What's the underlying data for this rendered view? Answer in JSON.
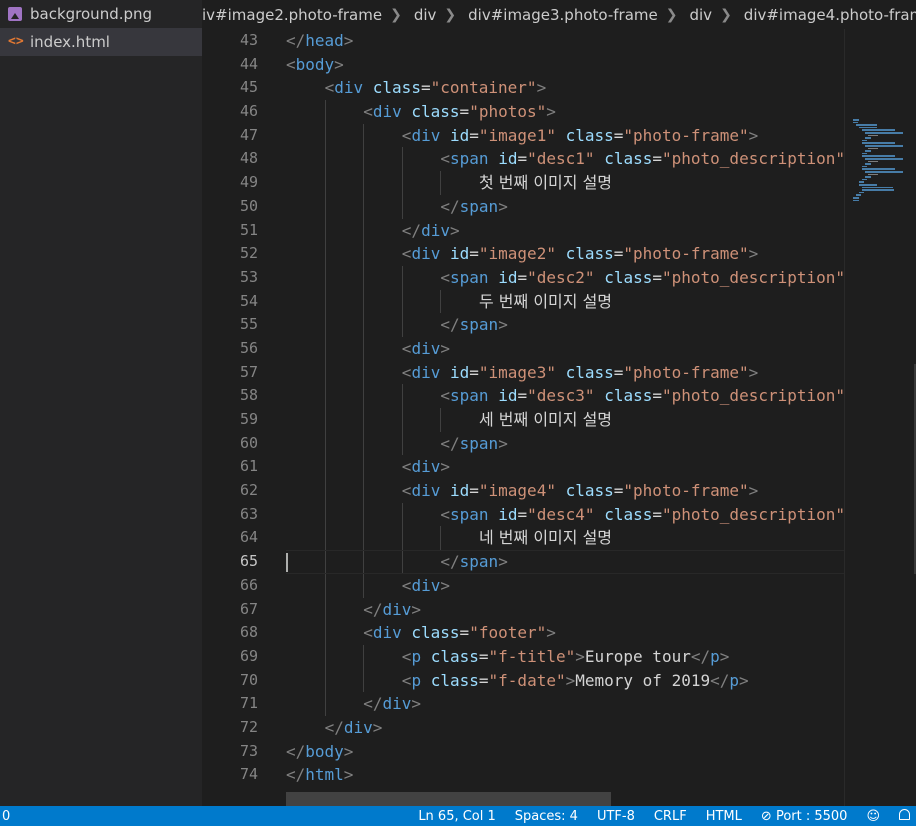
{
  "sidebar": {
    "files": [
      {
        "name": "background.png",
        "icon": "image-file-icon",
        "active": false
      },
      {
        "name": "index.html",
        "icon": "html-file-icon",
        "active": true
      }
    ]
  },
  "breadcrumb": {
    "items": [
      "iv#image2.photo-frame",
      "div",
      "div#image3.photo-frame",
      "div",
      "div#image4.photo-fram"
    ]
  },
  "editor": {
    "current_line": 65,
    "lines": [
      {
        "n": "43",
        "indent": 0,
        "tokens": [
          [
            "tb",
            "</"
          ],
          [
            "tg",
            "head"
          ],
          [
            "tb",
            ">"
          ]
        ]
      },
      {
        "n": "44",
        "indent": 0,
        "tokens": [
          [
            "tb",
            "<"
          ],
          [
            "tg",
            "body"
          ],
          [
            "tb",
            ">"
          ]
        ]
      },
      {
        "n": "45",
        "indent": 1,
        "tokens": [
          [
            "tb",
            "<"
          ],
          [
            "tg",
            "div"
          ],
          [
            "tx",
            " "
          ],
          [
            "at",
            "class"
          ],
          [
            "tx",
            "="
          ],
          [
            "st",
            "\"container\""
          ],
          [
            "tb",
            ">"
          ]
        ]
      },
      {
        "n": "46",
        "indent": 2,
        "tokens": [
          [
            "tb",
            "<"
          ],
          [
            "tg",
            "div"
          ],
          [
            "tx",
            " "
          ],
          [
            "at",
            "class"
          ],
          [
            "tx",
            "="
          ],
          [
            "st",
            "\"photos\""
          ],
          [
            "tb",
            ">"
          ]
        ]
      },
      {
        "n": "47",
        "indent": 3,
        "tokens": [
          [
            "tb",
            "<"
          ],
          [
            "tg",
            "div"
          ],
          [
            "tx",
            " "
          ],
          [
            "at",
            "id"
          ],
          [
            "tx",
            "="
          ],
          [
            "st",
            "\"image1\""
          ],
          [
            "tx",
            " "
          ],
          [
            "at",
            "class"
          ],
          [
            "tx",
            "="
          ],
          [
            "st",
            "\"photo-frame\""
          ],
          [
            "tb",
            ">"
          ]
        ]
      },
      {
        "n": "48",
        "indent": 4,
        "tokens": [
          [
            "tb",
            "<"
          ],
          [
            "tg",
            "span"
          ],
          [
            "tx",
            " "
          ],
          [
            "at",
            "id"
          ],
          [
            "tx",
            "="
          ],
          [
            "st",
            "\"desc1\""
          ],
          [
            "tx",
            " "
          ],
          [
            "at",
            "class"
          ],
          [
            "tx",
            "="
          ],
          [
            "st",
            "\"photo_description\""
          ]
        ]
      },
      {
        "n": "49",
        "indent": 5,
        "tokens": [
          [
            "kr",
            "첫 번째 이미지 설명"
          ]
        ]
      },
      {
        "n": "50",
        "indent": 4,
        "tokens": [
          [
            "tb",
            "</"
          ],
          [
            "tg",
            "span"
          ],
          [
            "tb",
            ">"
          ]
        ]
      },
      {
        "n": "51",
        "indent": 3,
        "tokens": [
          [
            "tb",
            "</"
          ],
          [
            "tg",
            "div"
          ],
          [
            "tb",
            ">"
          ]
        ]
      },
      {
        "n": "52",
        "indent": 3,
        "tokens": [
          [
            "tb",
            "<"
          ],
          [
            "tg",
            "div"
          ],
          [
            "tx",
            " "
          ],
          [
            "at",
            "id"
          ],
          [
            "tx",
            "="
          ],
          [
            "st",
            "\"image2\""
          ],
          [
            "tx",
            " "
          ],
          [
            "at",
            "class"
          ],
          [
            "tx",
            "="
          ],
          [
            "st",
            "\"photo-frame\""
          ],
          [
            "tb",
            ">"
          ]
        ]
      },
      {
        "n": "53",
        "indent": 4,
        "tokens": [
          [
            "tb",
            "<"
          ],
          [
            "tg",
            "span"
          ],
          [
            "tx",
            " "
          ],
          [
            "at",
            "id"
          ],
          [
            "tx",
            "="
          ],
          [
            "st",
            "\"desc2\""
          ],
          [
            "tx",
            " "
          ],
          [
            "at",
            "class"
          ],
          [
            "tx",
            "="
          ],
          [
            "st",
            "\"photo_description\""
          ]
        ]
      },
      {
        "n": "54",
        "indent": 5,
        "tokens": [
          [
            "kr",
            "두 번째 이미지 설명"
          ]
        ]
      },
      {
        "n": "55",
        "indent": 4,
        "tokens": [
          [
            "tb",
            "</"
          ],
          [
            "tg",
            "span"
          ],
          [
            "tb",
            ">"
          ]
        ]
      },
      {
        "n": "56",
        "indent": 3,
        "tokens": [
          [
            "tb",
            "<"
          ],
          [
            "tg",
            "div"
          ],
          [
            "tb",
            ">"
          ]
        ]
      },
      {
        "n": "57",
        "indent": 3,
        "tokens": [
          [
            "tb",
            "<"
          ],
          [
            "tg",
            "div"
          ],
          [
            "tx",
            " "
          ],
          [
            "at",
            "id"
          ],
          [
            "tx",
            "="
          ],
          [
            "st",
            "\"image3\""
          ],
          [
            "tx",
            " "
          ],
          [
            "at",
            "class"
          ],
          [
            "tx",
            "="
          ],
          [
            "st",
            "\"photo-frame\""
          ],
          [
            "tb",
            ">"
          ]
        ]
      },
      {
        "n": "58",
        "indent": 4,
        "tokens": [
          [
            "tb",
            "<"
          ],
          [
            "tg",
            "span"
          ],
          [
            "tx",
            " "
          ],
          [
            "at",
            "id"
          ],
          [
            "tx",
            "="
          ],
          [
            "st",
            "\"desc3\""
          ],
          [
            "tx",
            " "
          ],
          [
            "at",
            "class"
          ],
          [
            "tx",
            "="
          ],
          [
            "st",
            "\"photo_description\""
          ]
        ]
      },
      {
        "n": "59",
        "indent": 5,
        "tokens": [
          [
            "kr",
            "세 번째 이미지 설명"
          ]
        ]
      },
      {
        "n": "60",
        "indent": 4,
        "tokens": [
          [
            "tb",
            "</"
          ],
          [
            "tg",
            "span"
          ],
          [
            "tb",
            ">"
          ]
        ]
      },
      {
        "n": "61",
        "indent": 3,
        "tokens": [
          [
            "tb",
            "<"
          ],
          [
            "tg",
            "div"
          ],
          [
            "tb",
            ">"
          ]
        ]
      },
      {
        "n": "62",
        "indent": 3,
        "tokens": [
          [
            "tb",
            "<"
          ],
          [
            "tg",
            "div"
          ],
          [
            "tx",
            " "
          ],
          [
            "at",
            "id"
          ],
          [
            "tx",
            "="
          ],
          [
            "st",
            "\"image4\""
          ],
          [
            "tx",
            " "
          ],
          [
            "at",
            "class"
          ],
          [
            "tx",
            "="
          ],
          [
            "st",
            "\"photo-frame\""
          ],
          [
            "tb",
            ">"
          ]
        ]
      },
      {
        "n": "63",
        "indent": 4,
        "tokens": [
          [
            "tb",
            "<"
          ],
          [
            "tg",
            "span"
          ],
          [
            "tx",
            " "
          ],
          [
            "at",
            "id"
          ],
          [
            "tx",
            "="
          ],
          [
            "st",
            "\"desc4\""
          ],
          [
            "tx",
            " "
          ],
          [
            "at",
            "class"
          ],
          [
            "tx",
            "="
          ],
          [
            "st",
            "\"photo_description\""
          ]
        ]
      },
      {
        "n": "64",
        "indent": 5,
        "tokens": [
          [
            "kr",
            "네 번째 이미지 설명"
          ]
        ]
      },
      {
        "n": "65",
        "indent": 4,
        "tokens": [
          [
            "tb",
            "</"
          ],
          [
            "tg",
            "span"
          ],
          [
            "tb",
            ">"
          ]
        ]
      },
      {
        "n": "66",
        "indent": 3,
        "tokens": [
          [
            "tb",
            "<"
          ],
          [
            "tg",
            "div"
          ],
          [
            "tb",
            ">"
          ]
        ]
      },
      {
        "n": "67",
        "indent": 2,
        "tokens": [
          [
            "tb",
            "</"
          ],
          [
            "tg",
            "div"
          ],
          [
            "tb",
            ">"
          ]
        ]
      },
      {
        "n": "68",
        "indent": 2,
        "tokens": [
          [
            "tb",
            "<"
          ],
          [
            "tg",
            "div"
          ],
          [
            "tx",
            " "
          ],
          [
            "at",
            "class"
          ],
          [
            "tx",
            "="
          ],
          [
            "st",
            "\"footer\""
          ],
          [
            "tb",
            ">"
          ]
        ]
      },
      {
        "n": "69",
        "indent": 3,
        "tokens": [
          [
            "tb",
            "<"
          ],
          [
            "tg",
            "p"
          ],
          [
            "tx",
            " "
          ],
          [
            "at",
            "class"
          ],
          [
            "tx",
            "="
          ],
          [
            "st",
            "\"f-title\""
          ],
          [
            "tb",
            ">"
          ],
          [
            "tx",
            "Europe tour"
          ],
          [
            "tb",
            "</"
          ],
          [
            "tg",
            "p"
          ],
          [
            "tb",
            ">"
          ]
        ]
      },
      {
        "n": "70",
        "indent": 3,
        "tokens": [
          [
            "tb",
            "<"
          ],
          [
            "tg",
            "p"
          ],
          [
            "tx",
            " "
          ],
          [
            "at",
            "class"
          ],
          [
            "tx",
            "="
          ],
          [
            "st",
            "\"f-date\""
          ],
          [
            "tb",
            ">"
          ],
          [
            "tx",
            "Memory of 2019"
          ],
          [
            "tb",
            "</"
          ],
          [
            "tg",
            "p"
          ],
          [
            "tb",
            ">"
          ]
        ]
      },
      {
        "n": "71",
        "indent": 2,
        "tokens": [
          [
            "tb",
            "</"
          ],
          [
            "tg",
            "div"
          ],
          [
            "tb",
            ">"
          ]
        ]
      },
      {
        "n": "72",
        "indent": 1,
        "tokens": [
          [
            "tb",
            "</"
          ],
          [
            "tg",
            "div"
          ],
          [
            "tb",
            ">"
          ]
        ]
      },
      {
        "n": "73",
        "indent": 0,
        "tokens": [
          [
            "tb",
            "</"
          ],
          [
            "tg",
            "body"
          ],
          [
            "tb",
            ">"
          ]
        ]
      },
      {
        "n": "74",
        "indent": 0,
        "tokens": [
          [
            "tb",
            "</"
          ],
          [
            "tg",
            "html"
          ],
          [
            "tb",
            ">"
          ]
        ]
      }
    ]
  },
  "statusbar": {
    "left": "0",
    "position": "Ln 65, Col 1",
    "spaces": "Spaces: 4",
    "encoding": "UTF-8",
    "eol": "CRLF",
    "language": "HTML",
    "port": "Port : 5500"
  },
  "colors": {
    "tag": "#569cd6",
    "attribute": "#9cdcfe",
    "string": "#ce9178",
    "bracket": "#808080",
    "text": "#d4d4d4",
    "statusbar": "#007acc",
    "editor_bg": "#1e1e1e",
    "sidebar_bg": "#252526"
  }
}
